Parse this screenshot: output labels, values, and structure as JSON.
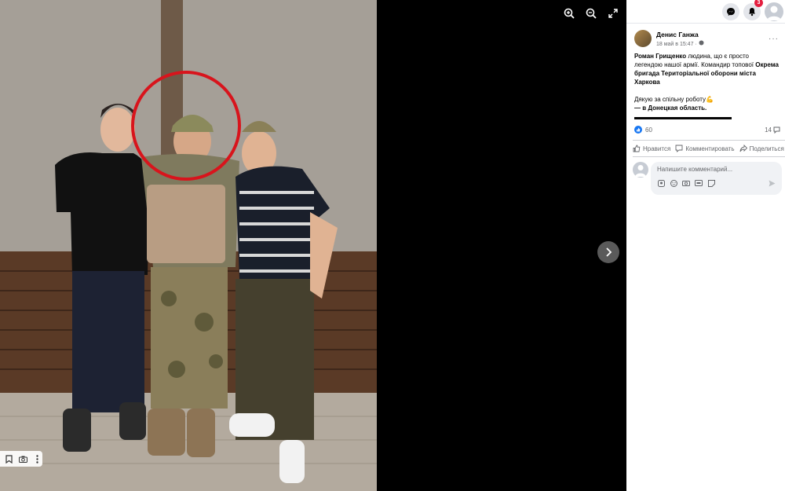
{
  "viewer": {
    "tools": [
      "zoom-in-icon",
      "zoom-out-icon",
      "fullscreen-icon"
    ],
    "next_icon": "chevron-right-icon",
    "photo_actions": [
      "bookmark-icon",
      "camera-icon",
      "more-vert-icon"
    ]
  },
  "topbar": {
    "messenger_icon": "messenger-icon",
    "notifications_count": "3",
    "notifications_icon": "bell-icon",
    "profile_icon": "avatar"
  },
  "post": {
    "author": "Денис Ганжа",
    "meta": "18 май в 15:47 · ",
    "more": "···",
    "text_p1_bold": "Роман Грищенко",
    "text_p1_rest": " людина, що є просто легендою нашої армії. Командир топової ",
    "text_p1_bold2": "Окрема бригада Територіальної оборони міста Харкова",
    "text_p2": "Дякую за спільну роботу💪",
    "text_location_prefix": "— в ",
    "text_location": "Донецкая область",
    "text_location_suffix": ".",
    "likes_count": "60",
    "comments_count": "14",
    "actions": {
      "like": "Нравится",
      "comment": "Комментировать",
      "share": "Поделиться"
    },
    "comment_placeholder": "Напишите комментарий..."
  },
  "colors": {
    "accent": "#1877f2",
    "badge": "#e41e3f",
    "circle": "#d8141c"
  }
}
